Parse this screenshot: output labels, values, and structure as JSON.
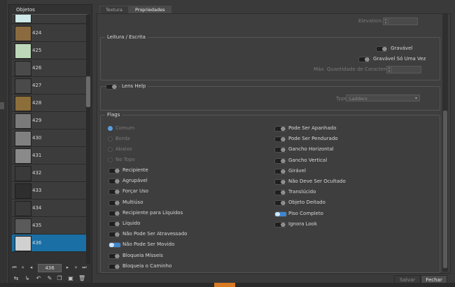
{
  "objects_panel": {
    "title": "Objetos",
    "items": [
      {
        "id": "",
        "thumb_color": "#cfe8e8"
      },
      {
        "id": "424",
        "thumb_color": "#8a6a3e"
      },
      {
        "id": "425",
        "thumb_color": "#bcd8b8"
      },
      {
        "id": "426",
        "thumb_color": "#4a4a4a"
      },
      {
        "id": "427",
        "thumb_color": "#4a4a4a"
      },
      {
        "id": "428",
        "thumb_color": "#8c6e3a"
      },
      {
        "id": "429",
        "thumb_color": "#7a7a7a"
      },
      {
        "id": "430",
        "thumb_color": "#808080"
      },
      {
        "id": "431",
        "thumb_color": "#8a8a8a"
      },
      {
        "id": "432",
        "thumb_color": "#3a3a3a"
      },
      {
        "id": "433",
        "thumb_color": "#2e2e2e"
      },
      {
        "id": "434",
        "thumb_color": "#3a3a3a"
      },
      {
        "id": "435",
        "thumb_color": "#5a5a5a"
      },
      {
        "id": "436",
        "thumb_color": "#d0d0d0"
      }
    ],
    "selected_id": "436",
    "page_value": "436"
  },
  "tabs": [
    {
      "label": "Textura"
    },
    {
      "label": "Propriedades"
    }
  ],
  "properties": {
    "elevation_label": "Elevation:",
    "rw_section": "Leitura / Escrita",
    "writable_label": "Gravável",
    "write_once_label": "Gravável Só Uma Vez",
    "max_chars_label": "Máx. Quantidade de Caracteres",
    "lens_help_label": "Lens Help",
    "type_label": "Type:",
    "type_value": "Ladders",
    "flags_section": "Flags",
    "flags_radios": [
      {
        "label": "Comum",
        "on": true
      },
      {
        "label": "Borda",
        "on": false
      },
      {
        "label": "Abaixo",
        "on": false
      },
      {
        "label": "No Topo",
        "on": false
      }
    ],
    "flags_left": [
      {
        "label": "Recipiente",
        "on": false
      },
      {
        "label": "Agrupável",
        "on": false
      },
      {
        "label": "Forçar Uso",
        "on": false
      },
      {
        "label": "Multiúso",
        "on": false
      },
      {
        "label": "Recipiente para Líquidos",
        "on": false
      },
      {
        "label": "Líquido",
        "on": false
      },
      {
        "label": "Não Pode Ser Atravessado",
        "on": false
      },
      {
        "label": "Não Pode Ser Movido",
        "on": true
      },
      {
        "label": "Bloqueia Mísseis",
        "on": false
      },
      {
        "label": "Bloqueia o Caminho",
        "on": false
      }
    ],
    "flags_right": [
      {
        "label": "Pode Ser Apanhado",
        "on": false
      },
      {
        "label": "Pode Ser Pendurado",
        "on": false
      },
      {
        "label": "Gancho Horizontal",
        "on": false
      },
      {
        "label": "Gancho Vertical",
        "on": false
      },
      {
        "label": "Girável",
        "on": false
      },
      {
        "label": "Não Deve Ser Ocultado",
        "on": false
      },
      {
        "label": "Translúcido",
        "on": false
      },
      {
        "label": "Objeto Deitado",
        "on": false
      },
      {
        "label": "Piso Completo",
        "on": true
      },
      {
        "label": "Ignora Look",
        "on": false
      }
    ]
  },
  "footer": {
    "save_label": "Salvar",
    "close_label": "Fechar"
  },
  "colors": {
    "selection": "#1a6fa5",
    "toggle_on": "#3f86d0"
  }
}
